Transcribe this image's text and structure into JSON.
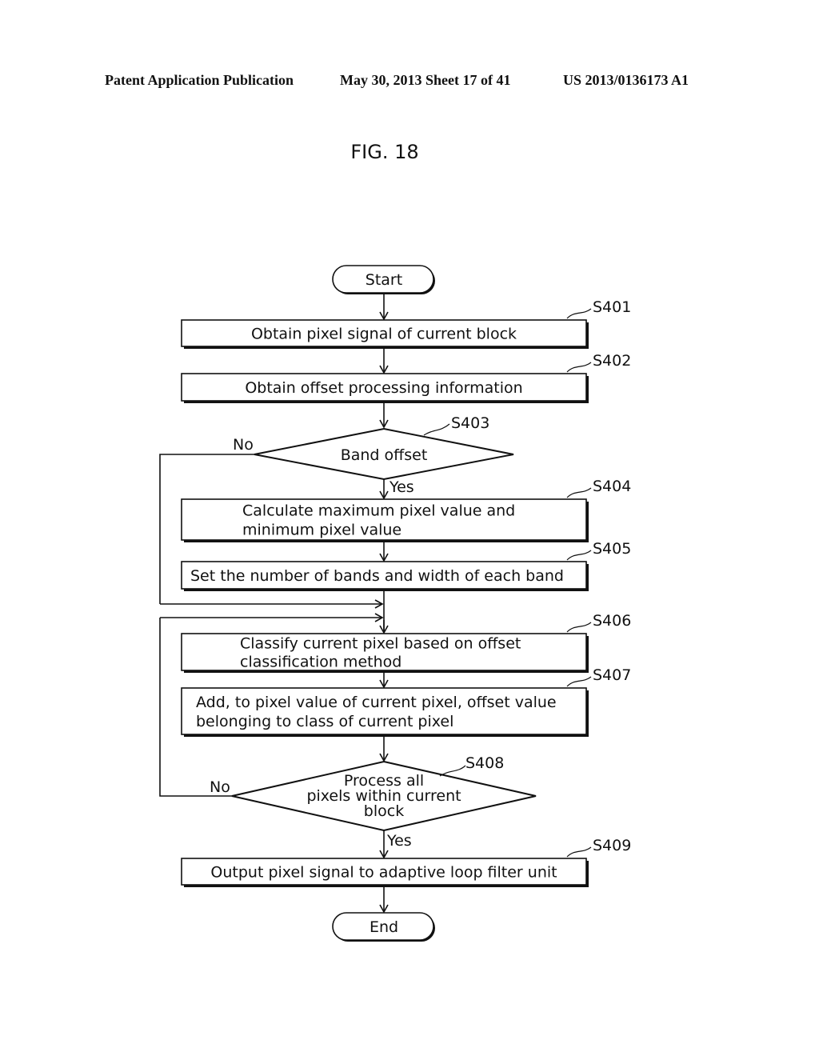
{
  "header": {
    "publication": "Patent Application Publication",
    "date_sheet": "May 30, 2013  Sheet 17 of 41",
    "number": "US 2013/0136173 A1"
  },
  "figure": {
    "title": "FIG. 18",
    "start": "Start",
    "end": "End",
    "steps": [
      {
        "id": "S401",
        "lines": [
          "Obtain pixel signal of current block"
        ]
      },
      {
        "id": "S402",
        "lines": [
          "Obtain offset processing information"
        ]
      },
      {
        "id": "S403",
        "lines": [
          "Band offset"
        ],
        "yes": "Yes",
        "no": "No"
      },
      {
        "id": "S404",
        "lines": [
          "Calculate maximum pixel value and",
          "minimum pixel value"
        ]
      },
      {
        "id": "S405",
        "lines": [
          "Set the number of bands and width of each band"
        ]
      },
      {
        "id": "S406",
        "lines": [
          "Classify current pixel based on offset",
          "classification method"
        ]
      },
      {
        "id": "S407",
        "lines": [
          "Add, to pixel value of current pixel, offset value",
          "belonging to class of current pixel"
        ]
      },
      {
        "id": "S408",
        "lines": [
          "Process all",
          "pixels within current",
          "block"
        ],
        "yes": "Yes",
        "no": "No"
      },
      {
        "id": "S409",
        "lines": [
          "Output pixel signal to adaptive loop filter unit"
        ]
      }
    ]
  }
}
